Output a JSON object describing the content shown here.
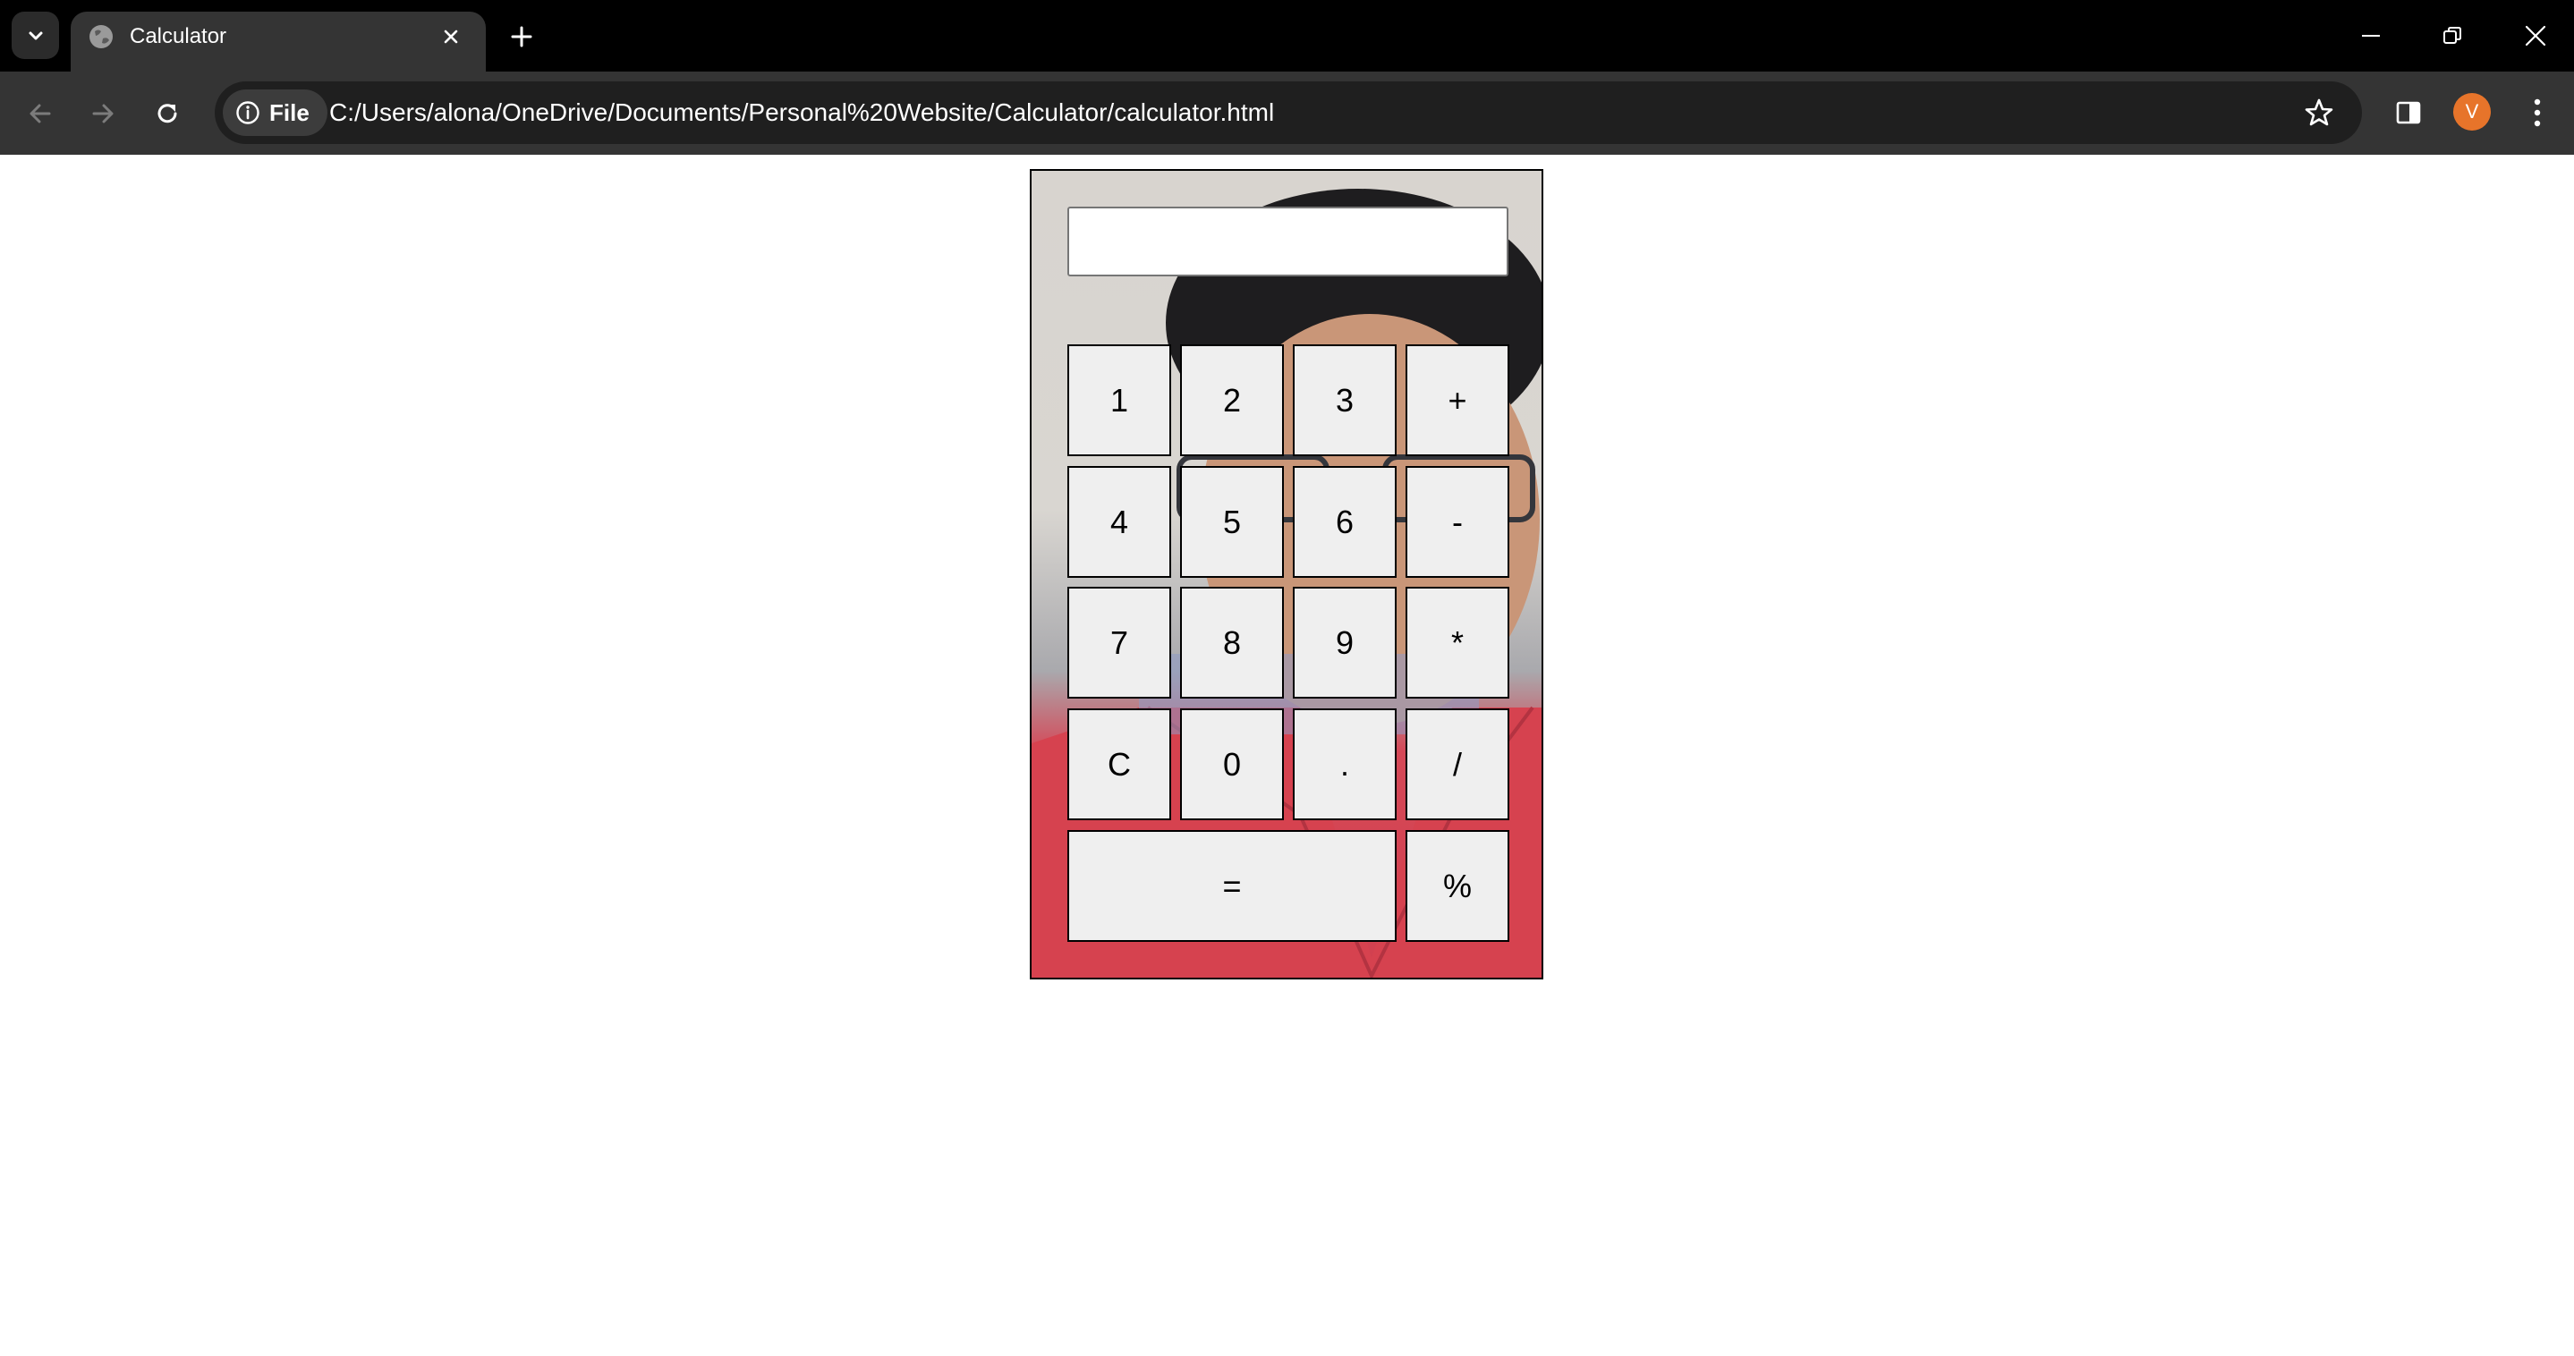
{
  "browser": {
    "tab_title": "Calculator",
    "omnibox_chip": "File",
    "url": "C:/Users/alona/OneDrive/Documents/Personal%20Website/Calculator/calculator.html",
    "profile_initial": "V",
    "profile_color": "#e7742a"
  },
  "calculator": {
    "display_value": "",
    "keys": {
      "k1": "1",
      "k2": "2",
      "k3": "3",
      "plus": "+",
      "k4": "4",
      "k5": "5",
      "k6": "6",
      "minus": "-",
      "k7": "7",
      "k8": "8",
      "k9": "9",
      "multiply": "*",
      "clear": "C",
      "k0": "0",
      "decimal": ".",
      "divide": "/",
      "equals": "=",
      "percent": "%"
    }
  }
}
